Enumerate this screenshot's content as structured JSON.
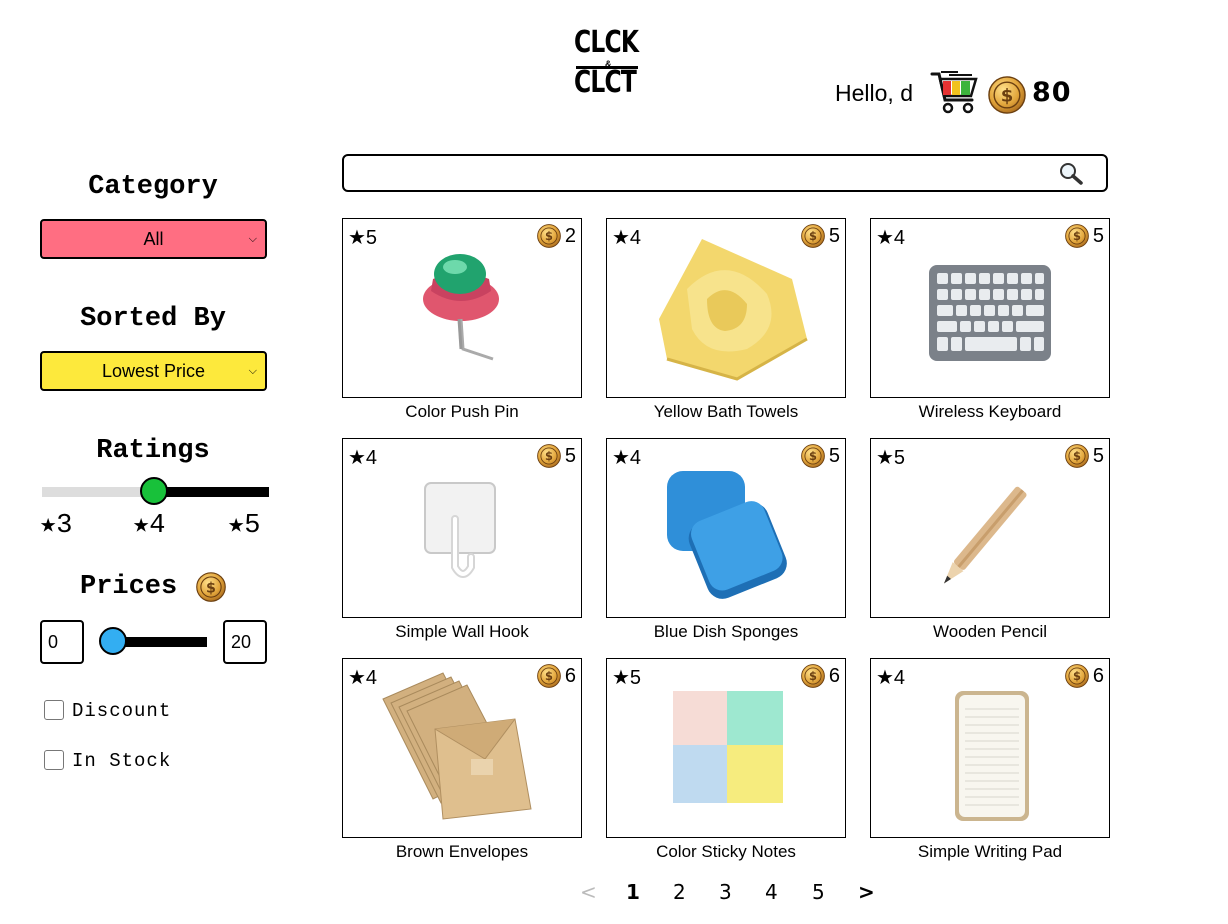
{
  "header": {
    "logo_line1": "CLCK",
    "logo_amp": "&",
    "logo_line2": "CLCT",
    "greeting": "Hello, d",
    "balance": "80",
    "icons": [
      "cart-icon",
      "coin-icon"
    ]
  },
  "sidebar": {
    "category_title": "Category",
    "category_value": "All",
    "sorted_title": "Sorted By",
    "sorted_value": "Lowest Price",
    "ratings_title": "Ratings",
    "rating_labels": [
      "★3",
      "★4",
      "★5"
    ],
    "rating_selected": 4,
    "prices_title": "Prices",
    "price_min": "0",
    "price_max": "20",
    "discount_label": "Discount",
    "instock_label": "In Stock"
  },
  "search": {
    "placeholder": "",
    "icon": "search-icon"
  },
  "products": [
    {
      "name": "Color Push Pin",
      "rating": "★5",
      "price": "2"
    },
    {
      "name": "Yellow Bath Towels",
      "rating": "★4",
      "price": "5"
    },
    {
      "name": "Wireless Keyboard",
      "rating": "★4",
      "price": "5"
    },
    {
      "name": "Simple Wall Hook",
      "rating": "★4",
      "price": "5"
    },
    {
      "name": "Blue Dish Sponges",
      "rating": "★4",
      "price": "5"
    },
    {
      "name": "Wooden Pencil",
      "rating": "★5",
      "price": "5"
    },
    {
      "name": "Brown Envelopes",
      "rating": "★4",
      "price": "6"
    },
    {
      "name": "Color Sticky Notes",
      "rating": "★5",
      "price": "6"
    },
    {
      "name": "Simple Writing Pad",
      "rating": "★4",
      "price": "6"
    }
  ],
  "pagination": {
    "prev": "<",
    "pages": [
      "1",
      "2",
      "3",
      "4",
      "5"
    ],
    "current": "1",
    "next": ">"
  },
  "colors": {
    "category_bg": "#ff6e82",
    "sorted_bg": "#fde93c",
    "rating_thumb": "#18c13a",
    "price_thumb": "#33aef2",
    "coin": "#e0a63a"
  }
}
